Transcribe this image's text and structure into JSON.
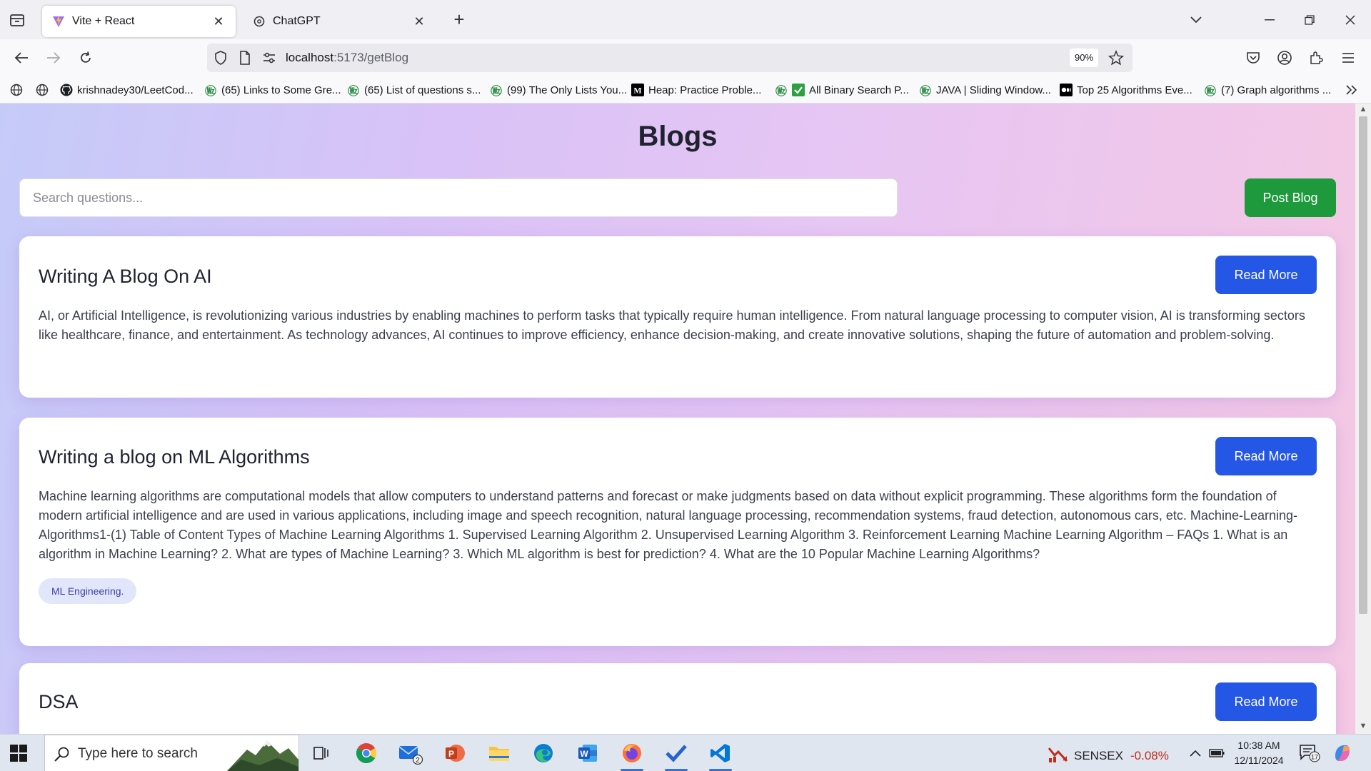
{
  "browser": {
    "tabs": [
      {
        "title": "Vite + React",
        "active": true,
        "icon": "vite-icon"
      },
      {
        "title": "ChatGPT",
        "active": false,
        "icon": "chatgpt-icon"
      }
    ],
    "url_host": "localhost",
    "url_path": ":5173/getBlog",
    "zoom": "90%",
    "bookmarks": [
      {
        "label": "krishnadey30/LeetCod...",
        "icon": "github-icon"
      },
      {
        "label": "(65) Links to Some Gre...",
        "icon": "gfg-icon"
      },
      {
        "label": "(65) List of questions s...",
        "icon": "gfg-icon"
      },
      {
        "label": "(99) The Only Lists You...",
        "icon": "gfg-icon"
      },
      {
        "label": "Heap: Practice Proble...",
        "icon": "medium-icon"
      },
      {
        "label": "All Binary Search P...",
        "icon": "checkbox-icon"
      },
      {
        "label": "JAVA | Sliding Window...",
        "icon": "gfg-icon"
      },
      {
        "label": "Top 25 Algorithms Eve...",
        "icon": "medium-icon"
      },
      {
        "label": "(7) Graph algorithms ...",
        "icon": "gfg-icon"
      }
    ]
  },
  "page": {
    "title": "Blogs",
    "search_placeholder": "Search questions...",
    "post_button": "Post Blog",
    "read_more": "Read More",
    "blogs": [
      {
        "title": "Writing A Blog On AI",
        "body": "AI, or Artificial Intelligence, is revolutionizing various industries by enabling machines to perform tasks that typically require human intelligence. From natural language processing to computer vision, AI is transforming sectors like healthcare, finance, and entertainment. As technology advances, AI continues to improve efficiency, enhance decision-making, and create innovative solutions, shaping the future of automation and problem-solving.",
        "tag": ""
      },
      {
        "title": "Writing a blog on ML Algorithms",
        "body": "Machine learning algorithms are computational models that allow computers to understand patterns and forecast or make judgments based on data without explicit programming. These algorithms form the foundation of modern artificial intelligence and are used in various applications, including image and speech recognition, natural language processing, recommendation systems, fraud detection, autonomous cars, etc. Machine-Learning-Algorithms1-(1) Table of Content Types of Machine Learning Algorithms 1. Supervised Learning Algorithm 2. Unsupervised Learning Algorithm 3. Reinforcement Learning Machine Learning Algorithm – FAQs 1. What is an algorithm in Machine Learning? 2. What are types of Machine Learning? 3. Which ML algorithm is best for prediction? 4. What are the 10 Popular Machine Learning Algorithms?",
        "tag": "ML Engineering."
      },
      {
        "title": "DSA",
        "body": "",
        "tag": ""
      }
    ]
  },
  "taskbar": {
    "search_placeholder": "Type here to search",
    "mail_badge": "2",
    "sensex_label": "SENSEX",
    "sensex_value": "-0.08%",
    "time": "10:38 AM",
    "date": "12/11/2024",
    "notification_count": "17"
  },
  "colors": {
    "post_button": "#1e9a3c",
    "read_more_button": "#2457e6",
    "tag_bg": "#e2e6fb",
    "sensex_negative": "#c42b1c"
  }
}
